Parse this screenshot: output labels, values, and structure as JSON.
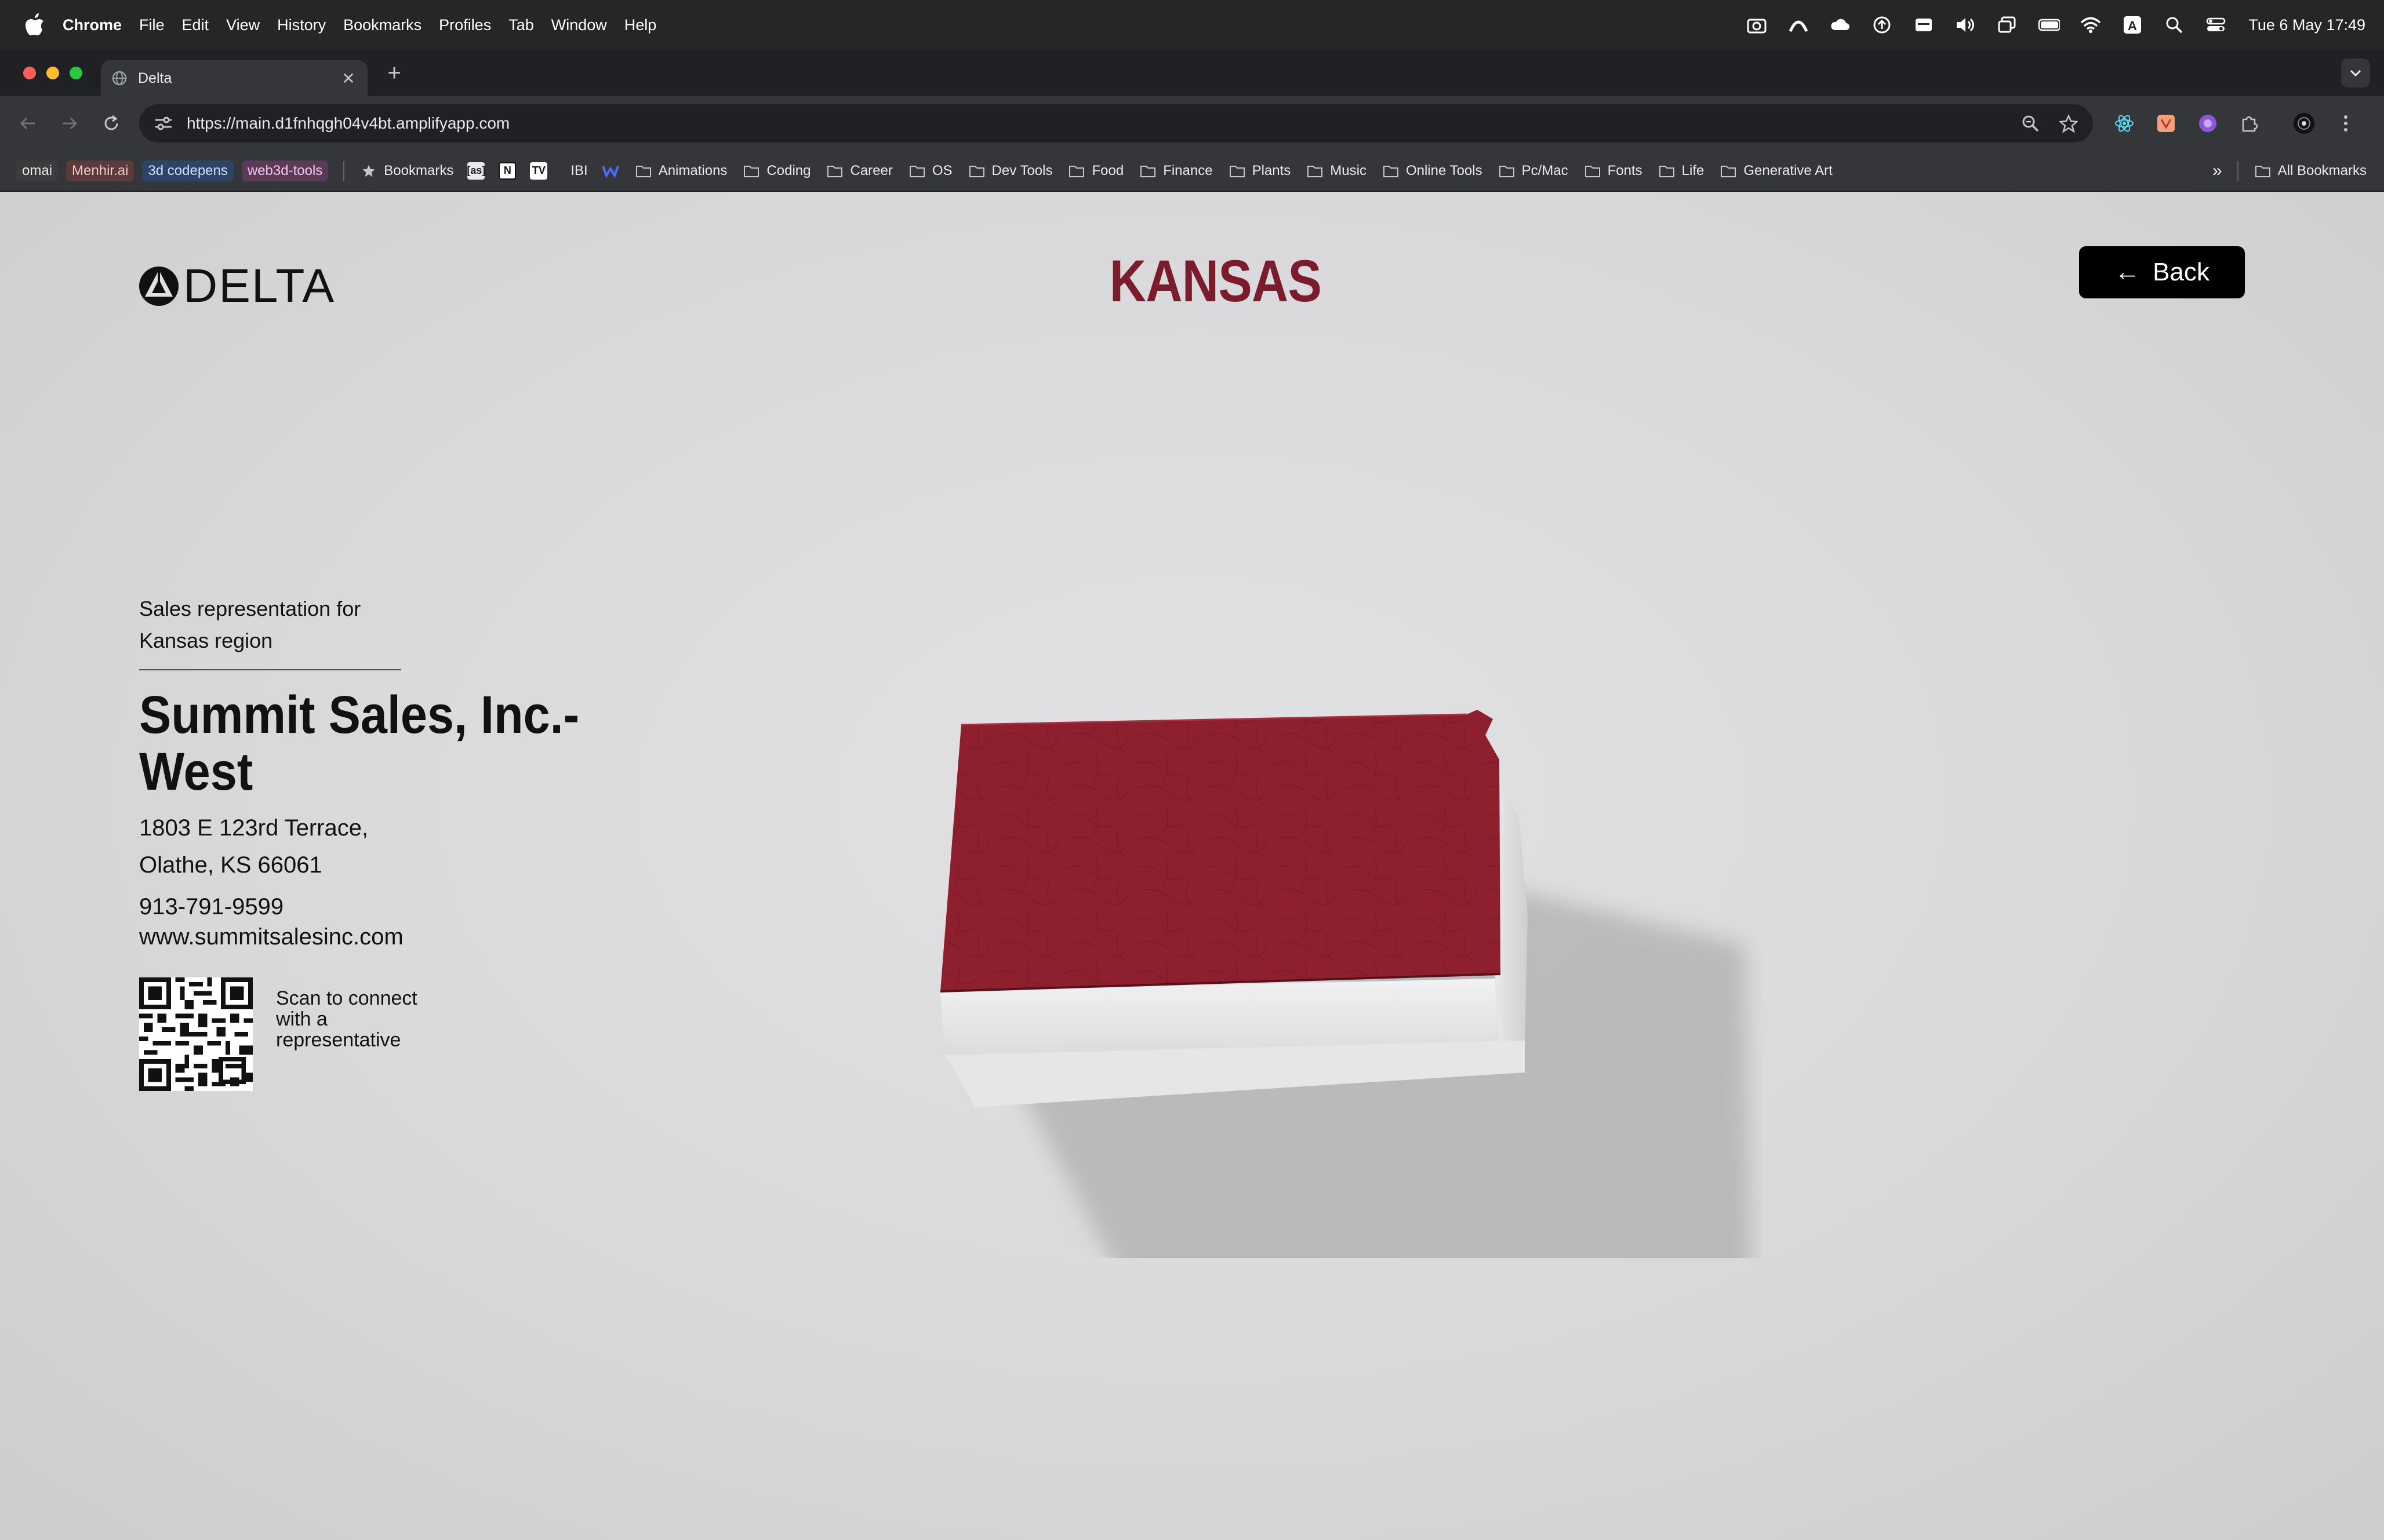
{
  "menubar": {
    "app": "Chrome",
    "items": [
      "File",
      "Edit",
      "View",
      "History",
      "Bookmarks",
      "Profiles",
      "Tab",
      "Window",
      "Help"
    ],
    "clock": "Tue 6 May  17:49"
  },
  "browser": {
    "tab_title": "Delta",
    "url": "https://main.d1fnhqgh04v4bt.amplifyapp.com",
    "bookmark_chips": [
      {
        "label": "omai",
        "bg": "#3c3c3c",
        "fg": "#e8eaed"
      },
      {
        "label": "Menhir.ai",
        "bg": "#5a3a3a",
        "fg": "#f0c8c8"
      },
      {
        "label": "3d codepens",
        "bg": "#2e4466",
        "fg": "#cfe0ff"
      },
      {
        "label": "web3d-tools",
        "bg": "#5a3a56",
        "fg": "#f3c6ee"
      }
    ],
    "bookmarks_star_label": "Bookmarks",
    "bookmark_icon_labels": [
      "[as]",
      "N",
      "TV",
      "IBI"
    ],
    "bookmark_folders": [
      "Animations",
      "Coding",
      "Career",
      "OS",
      "Dev Tools",
      "Food",
      "Finance",
      "Plants",
      "Music",
      "Online Tools",
      "Pc/Mac",
      "Fonts",
      "Life",
      "Generative Art"
    ],
    "all_bookmarks": "All Bookmarks"
  },
  "page": {
    "logo_text": "DELTA",
    "state_title": "KANSAS",
    "back_label": "Back",
    "rep_label": "Sales representation for Kansas region",
    "company": "Summit Sales, Inc.-West",
    "address_line1": "1803 E 123rd Terrace,",
    "address_line2": "Olathe, KS 66061",
    "phone": "913-791-9599",
    "website": "www.summitsalesinc.com",
    "qr_caption": "Scan to connect with a representative",
    "accent_color": "#7b1c2c",
    "map_color": "#8e1f2e"
  }
}
